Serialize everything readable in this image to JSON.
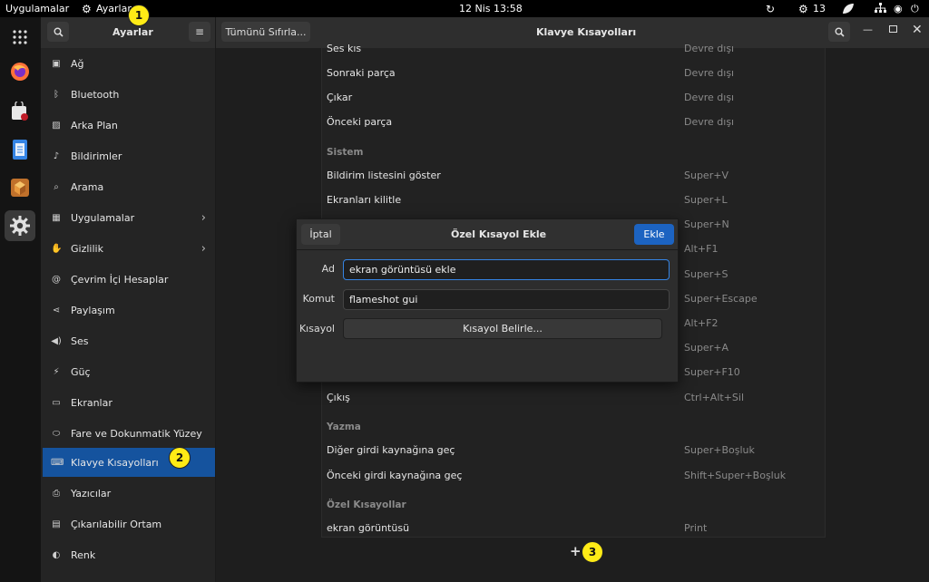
{
  "topbar": {
    "apps": "Uygulamalar",
    "active_app": "Ayarlar",
    "clock": "12 Nis  13:58",
    "notif_count": "13"
  },
  "sidebar": {
    "title": "Ayarlar",
    "items": [
      {
        "label": "Ağ",
        "icon": "network-icon"
      },
      {
        "label": "Bluetooth",
        "icon": "bluetooth-icon"
      },
      {
        "label": "Arka Plan",
        "icon": "background-icon"
      },
      {
        "label": "Bildirimler",
        "icon": "bell-icon"
      },
      {
        "label": "Arama",
        "icon": "search-icon"
      },
      {
        "label": "Uygulamalar",
        "icon": "apps-grid-icon"
      },
      {
        "label": "Gizlilik",
        "icon": "hand-icon"
      },
      {
        "label": "Çevrim İçi Hesaplar",
        "icon": "at-icon"
      },
      {
        "label": "Paylaşım",
        "icon": "share-icon"
      },
      {
        "label": "Ses",
        "icon": "speaker-icon"
      },
      {
        "label": "Güç",
        "icon": "power-icon"
      },
      {
        "label": "Ekranlar",
        "icon": "display-icon"
      },
      {
        "label": "Fare ve Dokunmatik Yüzey",
        "icon": "mouse-icon"
      },
      {
        "label": "Klavye Kısayolları",
        "icon": "keyboard-icon"
      },
      {
        "label": "Yazıcılar",
        "icon": "printer-icon"
      },
      {
        "label": "Çıkarılabilir Ortam",
        "icon": "media-icon"
      },
      {
        "label": "Renk",
        "icon": "palette-icon"
      }
    ]
  },
  "header": {
    "reset_label": "Tümünü Sıfırla...",
    "title": "Klavye Kısayolları"
  },
  "shortcuts": {
    "top_rows": [
      {
        "name": "Ses kıs",
        "key": "Devre dışı"
      },
      {
        "name": "Sonraki parça",
        "key": "Devre dışı"
      },
      {
        "name": "Çıkar",
        "key": "Devre dışı"
      },
      {
        "name": "Önceki parça",
        "key": "Devre dışı"
      }
    ],
    "system_header": "Sistem",
    "system_rows": [
      {
        "name": "Bildirim listesini göster",
        "key": "Super+V"
      },
      {
        "name": "Ekranları kilitle",
        "key": "Super+L"
      },
      {
        "name": "",
        "key": "Super+N"
      },
      {
        "name": "",
        "key": "Alt+F1"
      },
      {
        "name": "",
        "key": "Super+S"
      },
      {
        "name": "",
        "key": "Super+Escape"
      },
      {
        "name": "",
        "key": "Alt+F2"
      },
      {
        "name": "",
        "key": "Super+A"
      },
      {
        "name": "",
        "key": "Super+F10"
      },
      {
        "name": "Çıkış",
        "key": "Ctrl+Alt+Sil"
      }
    ],
    "typing_header": "Yazma",
    "typing_rows": [
      {
        "name": "Diğer girdi kaynağına geç",
        "key": "Super+Boşluk"
      },
      {
        "name": "Önceki girdi kaynağına geç",
        "key": "Shift+Super+Boşluk"
      }
    ],
    "custom_header": "Özel Kısayollar",
    "custom_rows": [
      {
        "name": "ekran görüntüsü",
        "key": "Print"
      }
    ],
    "add_symbol": "+"
  },
  "dialog": {
    "cancel": "İptal",
    "title": "Özel Kısayol Ekle",
    "add": "Ekle",
    "name_label": "Ad",
    "name_value": "ekran görüntüsü ekle",
    "command_label": "Komut",
    "command_value": "flameshot gui",
    "shortcut_label": "Kısayol",
    "shortcut_button": "Kısayol Belirle..."
  },
  "badges": [
    "1",
    "2",
    "3"
  ]
}
